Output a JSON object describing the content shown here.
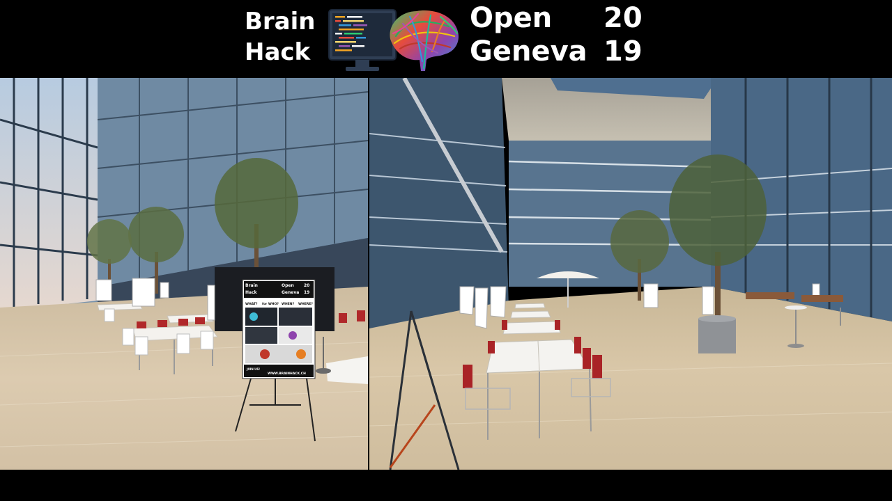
{
  "banner": {
    "word_brain": "Brain",
    "word_hack": "Hack",
    "word_open": "Open",
    "word_geneva": "Geneva",
    "year_top": "20",
    "year_bottom": "19",
    "icons": [
      "code-monitor-icon",
      "brain-tractography-icon"
    ]
  },
  "poster": {
    "word_brain": "Brain",
    "word_hack": "Hack",
    "word_open": "Open",
    "word_geneva": "Geneva",
    "year_top": "20",
    "year_bottom": "19",
    "questions": [
      "WHAT?",
      "for WHO?",
      "WHEN?",
      "WHERE?"
    ],
    "footer_url": "WWW.BRAINHACK.CH",
    "footer_tag": "JOIN US!"
  },
  "colors": {
    "background": "#000000",
    "banner_text": "#ffffff",
    "floor": "#d9c8ac",
    "chair_red": "#b0282a",
    "glass": "#4d6e8c"
  }
}
